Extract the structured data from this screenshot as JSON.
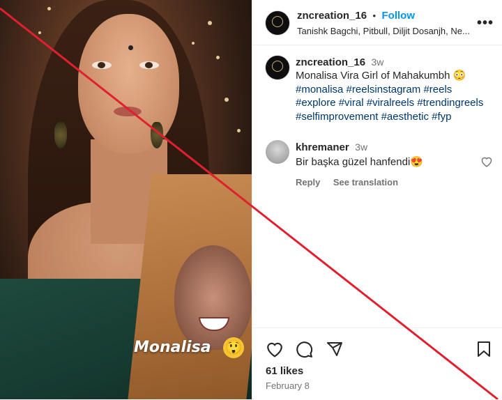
{
  "media": {
    "overlay_text": "Monalisa",
    "overlay_emoji": "😲"
  },
  "header": {
    "username": "zncreation_16",
    "separator": "•",
    "follow_label": "Follow",
    "audio_credit": "Tanishk Bagchi, Pitbull, Diljit Dosanjh, Ne...",
    "more_icon": "more-icon"
  },
  "caption": {
    "username": "zncreation_16",
    "time": "3w",
    "text": "Monalisa Vira Girl of Mahakumbh 😳",
    "hashtags": [
      "#monalisa",
      "#reelsinstagram",
      "#reels",
      "#explore",
      "#viral",
      "#viralreels",
      "#trendingreels",
      "#selfimprovement",
      "#aesthetic",
      "#fyp"
    ]
  },
  "comment": {
    "username": "khremaner",
    "time": "3w",
    "text": "Bir başka güzel hanfendi😍",
    "reply_label": "Reply",
    "translation_label": "See translation"
  },
  "actions": {
    "likes": "61 likes",
    "date": "February 8"
  },
  "colors": {
    "accent": "#0095f6",
    "hashtag": "#00376b",
    "muted": "#737373",
    "strike_line": "#e0202e"
  }
}
